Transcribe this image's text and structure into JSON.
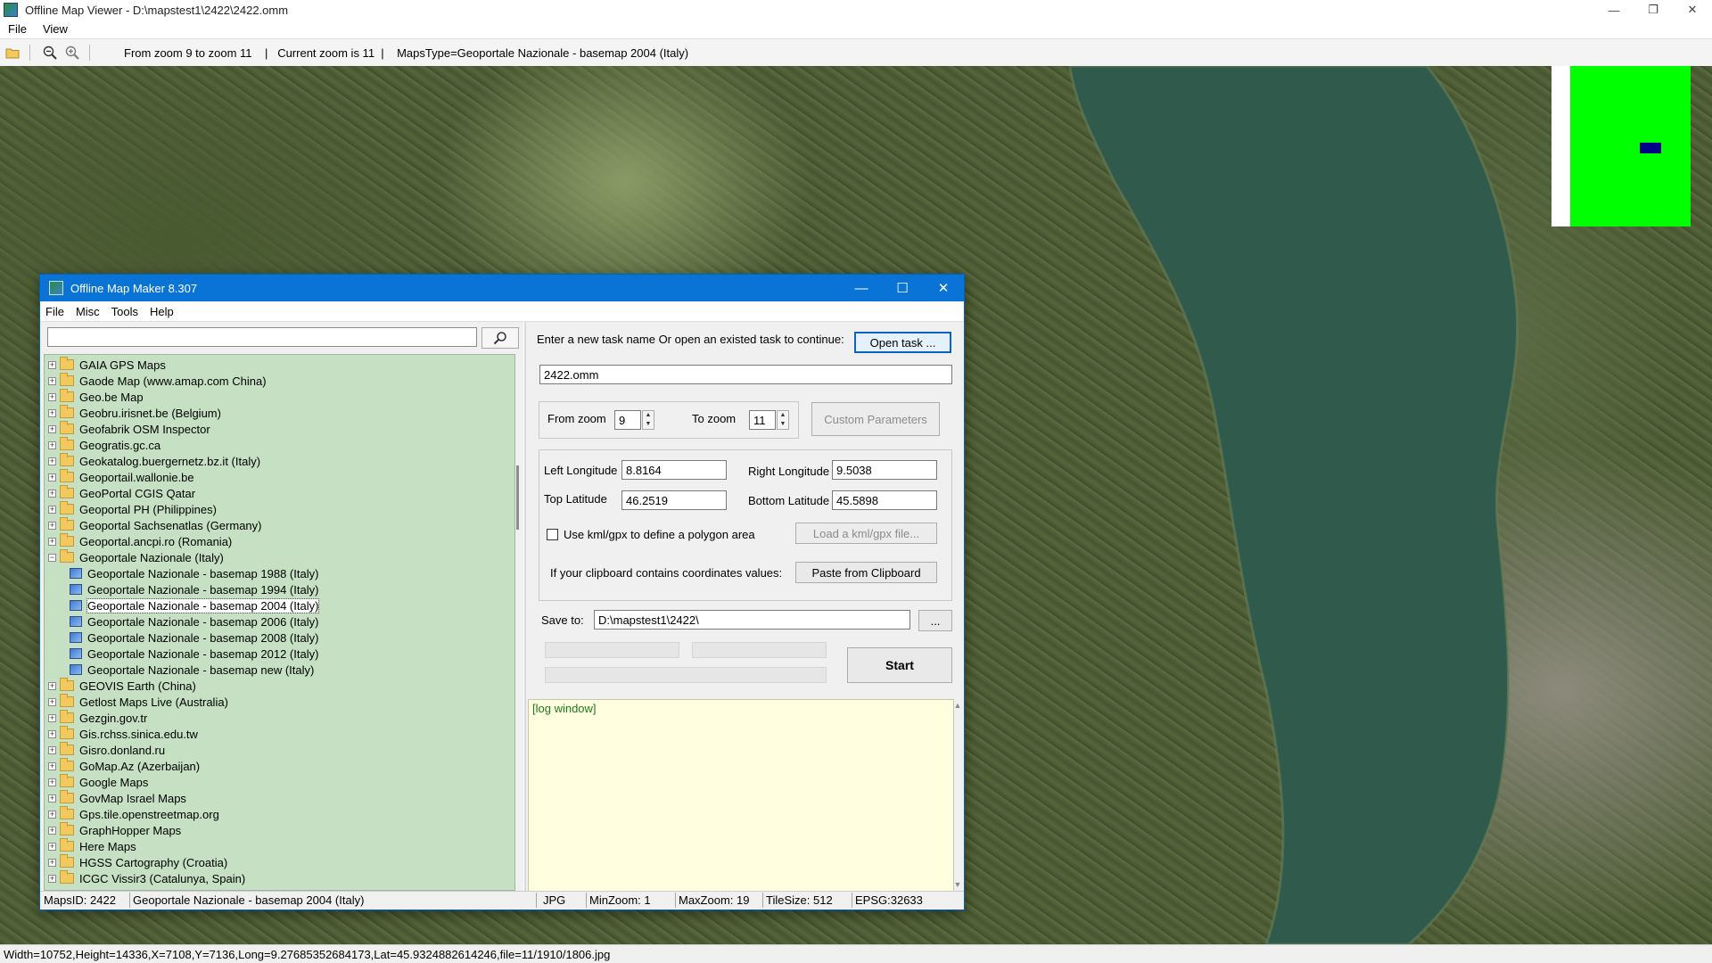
{
  "viewer": {
    "title": "Offline Map Viewer - D:\\mapstest1\\2422\\2422.omm",
    "menu": [
      "File",
      "View"
    ],
    "toolbar_info": "From zoom 9 to zoom 11    |   Current zoom is 11  |    MapsType=Geoportale Nazionale - basemap 2004 (Italy)",
    "status": "Width=10752,Height=14336,X=7108,Y=7136,Long=9.27685352684173,Lat=45.9324882614246,file=11/1910/1806.jpg",
    "colors": {
      "minimap_bg": "#00ff00",
      "minimap_marker": "#00008b",
      "lake": "#2f5a4c"
    }
  },
  "omm": {
    "title": "Offline Map Maker 8.307",
    "menu": [
      "File",
      "Misc",
      "Tools",
      "Help"
    ],
    "search_value": "",
    "tree": [
      {
        "label": "GAIA GPS Maps",
        "type": "folder",
        "state": "collapsed"
      },
      {
        "label": "Gaode Map (www.amap.com China)",
        "type": "folder",
        "state": "collapsed"
      },
      {
        "label": "Geo.be Map",
        "type": "folder",
        "state": "collapsed"
      },
      {
        "label": "Geobru.irisnet.be (Belgium)",
        "type": "folder",
        "state": "collapsed"
      },
      {
        "label": "Geofabrik OSM Inspector",
        "type": "folder",
        "state": "collapsed"
      },
      {
        "label": "Geogratis.gc.ca",
        "type": "folder",
        "state": "collapsed"
      },
      {
        "label": "Geokatalog.buergernetz.bz.it (Italy)",
        "type": "folder",
        "state": "collapsed"
      },
      {
        "label": "Geoportail.wallonie.be",
        "type": "folder",
        "state": "collapsed"
      },
      {
        "label": "GeoPortal CGIS Qatar",
        "type": "folder",
        "state": "collapsed"
      },
      {
        "label": "Geoportal PH (Philippines)",
        "type": "folder",
        "state": "collapsed"
      },
      {
        "label": "Geoportal Sachsenatlas (Germany)",
        "type": "folder",
        "state": "collapsed"
      },
      {
        "label": "Geoportal.ancpi.ro (Romania)",
        "type": "folder",
        "state": "collapsed"
      },
      {
        "label": "Geoportale Nazionale (Italy)",
        "type": "folder",
        "state": "expanded"
      },
      {
        "label": "Geoportale Nazionale - basemap 1988 (Italy)",
        "type": "map"
      },
      {
        "label": "Geoportale Nazionale - basemap 1994 (Italy)",
        "type": "map"
      },
      {
        "label": "Geoportale Nazionale - basemap 2004 (Italy)",
        "type": "map",
        "selected": true
      },
      {
        "label": "Geoportale Nazionale - basemap 2006 (Italy)",
        "type": "map"
      },
      {
        "label": "Geoportale Nazionale - basemap 2008 (Italy)",
        "type": "map"
      },
      {
        "label": "Geoportale Nazionale - basemap 2012 (Italy)",
        "type": "map"
      },
      {
        "label": "Geoportale Nazionale - basemap new (Italy)",
        "type": "map"
      },
      {
        "label": "GEOVIS Earth (China)",
        "type": "folder",
        "state": "collapsed"
      },
      {
        "label": "Getlost Maps Live (Australia)",
        "type": "folder",
        "state": "collapsed"
      },
      {
        "label": "Gezgin.gov.tr",
        "type": "folder",
        "state": "collapsed"
      },
      {
        "label": "Gis.rchss.sinica.edu.tw",
        "type": "folder",
        "state": "collapsed"
      },
      {
        "label": "Gisro.donland.ru",
        "type": "folder",
        "state": "collapsed"
      },
      {
        "label": "GoMap.Az (Azerbaijan)",
        "type": "folder",
        "state": "collapsed"
      },
      {
        "label": "Google Maps",
        "type": "folder",
        "state": "collapsed"
      },
      {
        "label": "GovMap Israel Maps",
        "type": "folder",
        "state": "collapsed"
      },
      {
        "label": "Gps.tile.openstreetmap.org",
        "type": "folder",
        "state": "collapsed"
      },
      {
        "label": "GraphHopper Maps",
        "type": "folder",
        "state": "collapsed"
      },
      {
        "label": "Here Maps",
        "type": "folder",
        "state": "collapsed"
      },
      {
        "label": "HGSS Cartography (Croatia)",
        "type": "folder",
        "state": "collapsed"
      },
      {
        "label": "ICGC Vissir3 (Catalunya, Spain)",
        "type": "folder",
        "state": "collapsed"
      }
    ],
    "task_prompt": "Enter a new task name Or open an existed task to continue:",
    "open_task_label": "Open task ...",
    "task_name": "2422.omm",
    "from_zoom_label": "From zoom",
    "from_zoom": "9",
    "to_zoom_label": "To zoom",
    "to_zoom": "11",
    "custom_params_label": "Custom Parameters",
    "left_lon_label": "Left Longitude",
    "left_lon": "8.8164",
    "right_lon_label": "Right Longitude",
    "right_lon": "9.5038",
    "top_lat_label": "Top Latitude",
    "top_lat": "46.2519",
    "bottom_lat_label": "Bottom Latitude",
    "bottom_lat": "45.5898",
    "kml_label": "Use kml/gpx to define a polygon area",
    "load_kml_label": "Load a kml/gpx file...",
    "clipboard_prompt": "If your clipboard contains coordinates values:",
    "paste_label": "Paste from Clipboard",
    "save_to_label": "Save to:",
    "save_path": "D:\\mapstest1\\2422\\",
    "browse_label": "...",
    "start_label": "Start",
    "log_text": "[log window]",
    "status": {
      "maps_id": "MapsID: 2422",
      "map_name": "Geoportale Nazionale - basemap 2004 (Italy)",
      "format": "JPG",
      "min_zoom": "MinZoom: 1",
      "max_zoom": "MaxZoom: 19",
      "tile_size": "TileSize: 512",
      "epsg": "EPSG:32633"
    }
  }
}
